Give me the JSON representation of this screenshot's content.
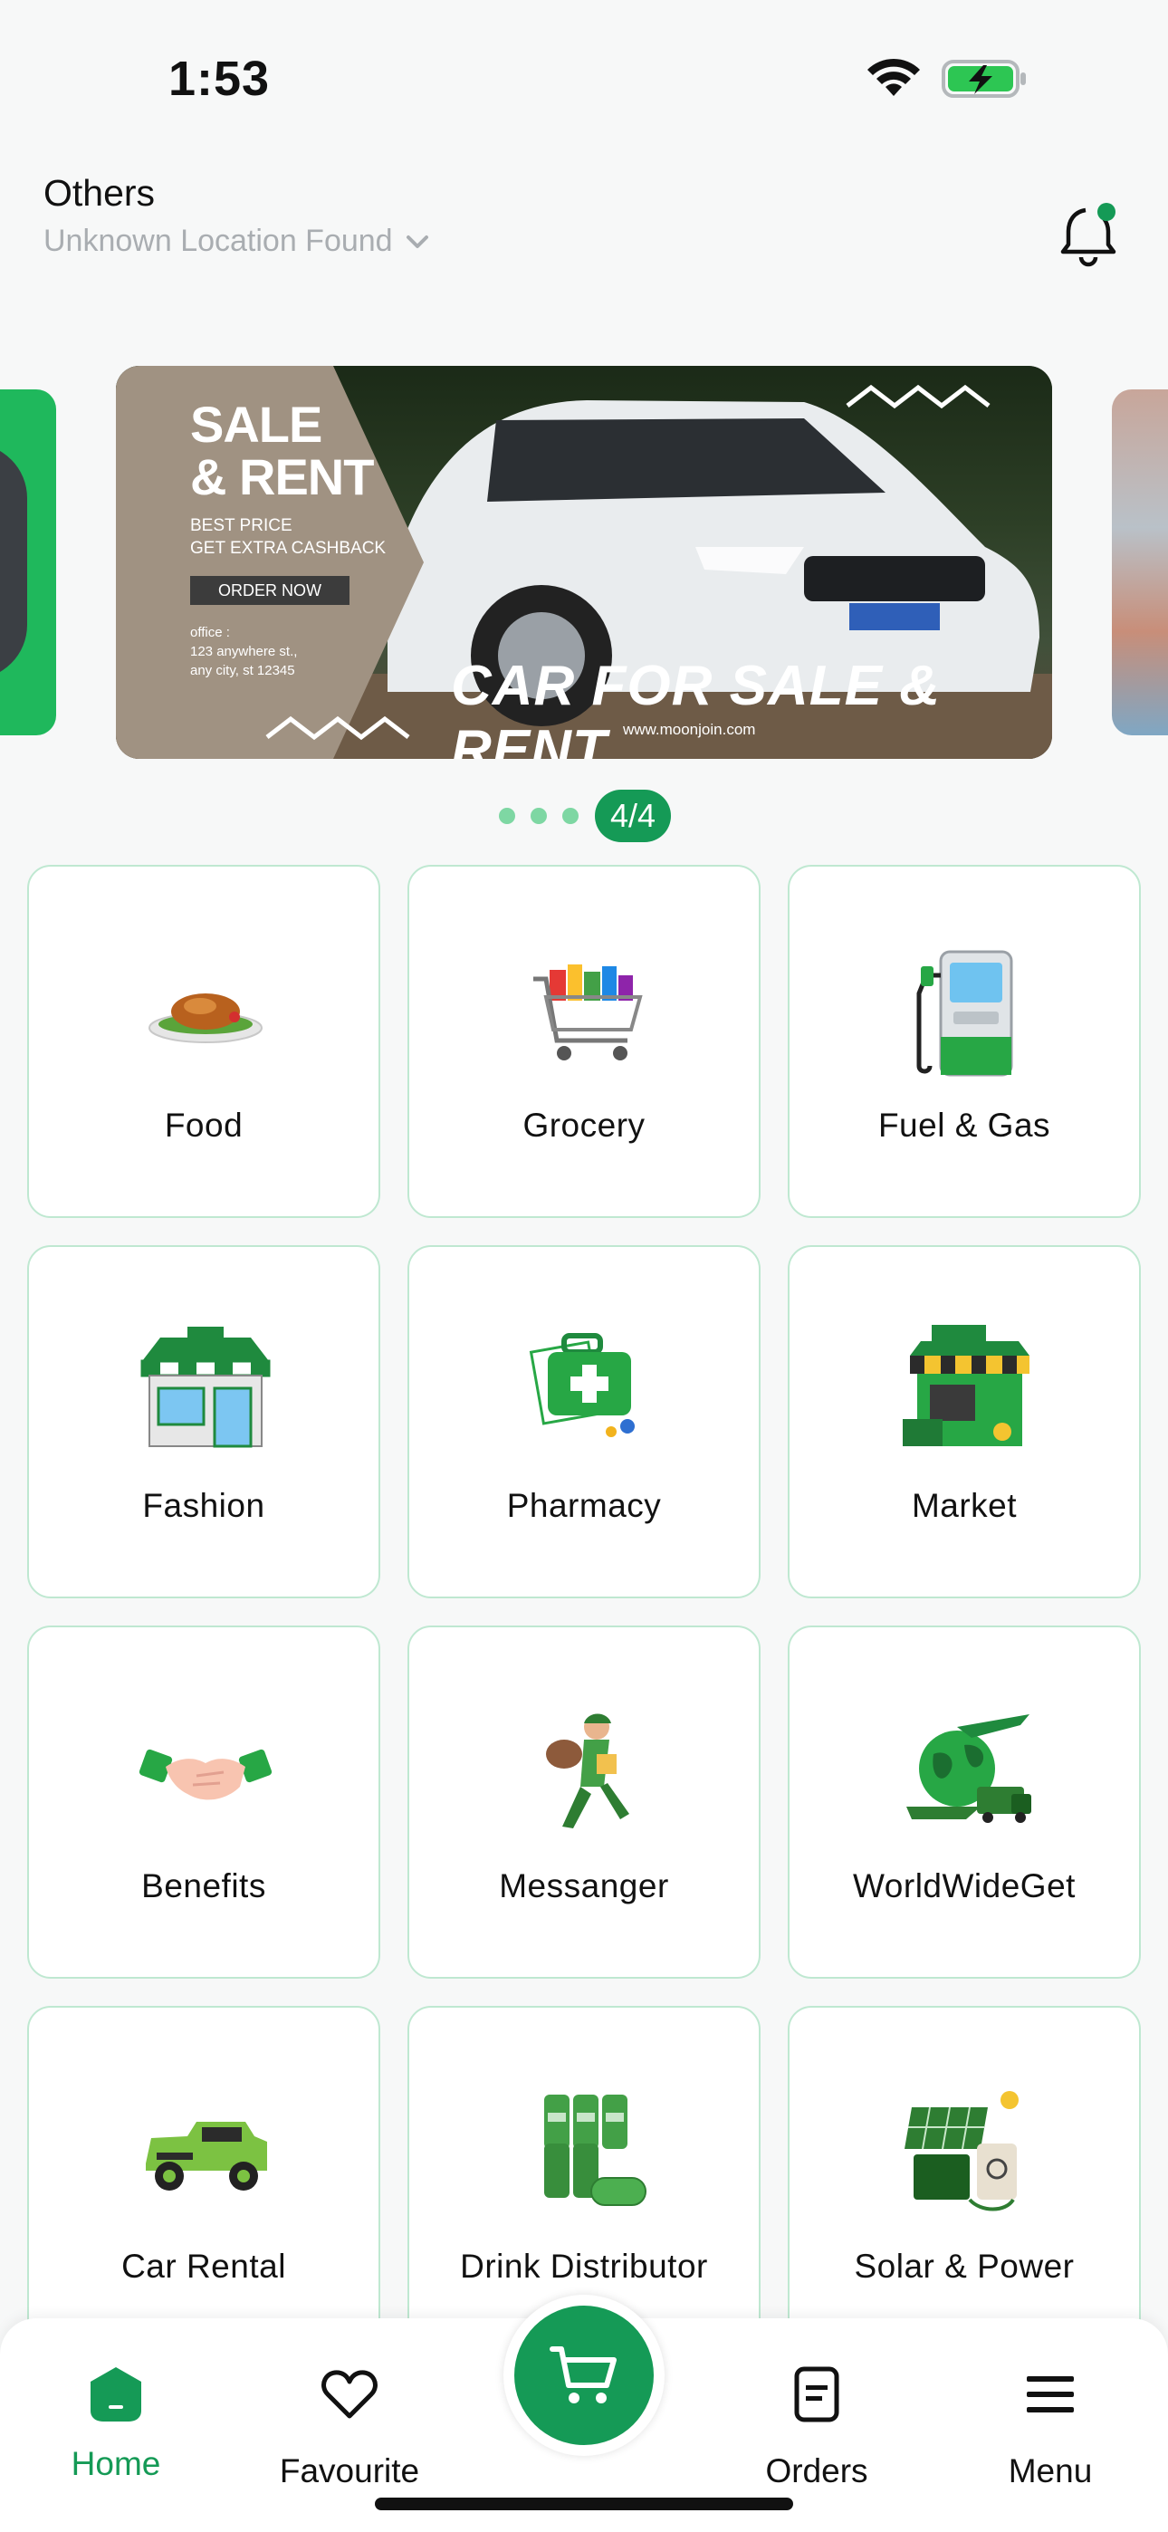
{
  "status_bar": {
    "time": "1:53"
  },
  "header": {
    "location_title": "Others",
    "location_subtitle": "Unknown Location Found"
  },
  "banner": {
    "sale_title_line1": "SALE",
    "sale_title_line2": "& RENT",
    "sub_line1": "BEST PRICE",
    "sub_line2": "GET EXTRA CASHBACK",
    "button_label": "ORDER NOW",
    "office_label": "office :",
    "office_line1": "123 anywhere st.,",
    "office_line2": "any city, st 12345",
    "headline": "CAR FOR SALE & RENT",
    "website": "www.moonjoin.com"
  },
  "carousel": {
    "indicator": "4/4"
  },
  "categories": [
    {
      "label": "Food",
      "icon": "food-plate-icon"
    },
    {
      "label": "Grocery",
      "icon": "grocery-cart-icon"
    },
    {
      "label": "Fuel & Gas",
      "icon": "fuel-pump-icon"
    },
    {
      "label": "Fashion",
      "icon": "shop-icon"
    },
    {
      "label": "Pharmacy",
      "icon": "medical-kit-icon"
    },
    {
      "label": "Market",
      "icon": "market-stall-icon"
    },
    {
      "label": "Benefits",
      "icon": "handshake-icon"
    },
    {
      "label": "Messanger",
      "icon": "courier-icon"
    },
    {
      "label": "WorldWideGet",
      "icon": "globe-plane-truck-icon"
    },
    {
      "label": "Car Rental",
      "icon": "jeep-icon"
    },
    {
      "label": "Drink Distributor",
      "icon": "drink-cans-icon"
    },
    {
      "label": "Solar & Power",
      "icon": "solar-panel-icon"
    }
  ],
  "nav": {
    "home": "Home",
    "favourite": "Favourite",
    "orders": "Orders",
    "menu": "Menu"
  },
  "colors": {
    "accent": "#159a56",
    "tile_border": "#bfe8d1",
    "muted_text": "#a9adb1"
  }
}
